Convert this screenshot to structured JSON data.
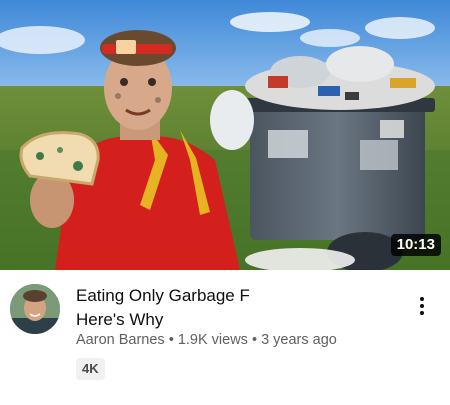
{
  "video": {
    "title_line1": "Eating Only Garbage F",
    "title_line2": "Here's Why",
    "duration": "10:13",
    "channel": "Aaron Barnes",
    "views": "1.9K views",
    "age": "3 years ago",
    "separator": "•",
    "quality_badge": "4K"
  },
  "icons": {
    "more": "more-vert-icon",
    "avatar": "channel-avatar"
  }
}
